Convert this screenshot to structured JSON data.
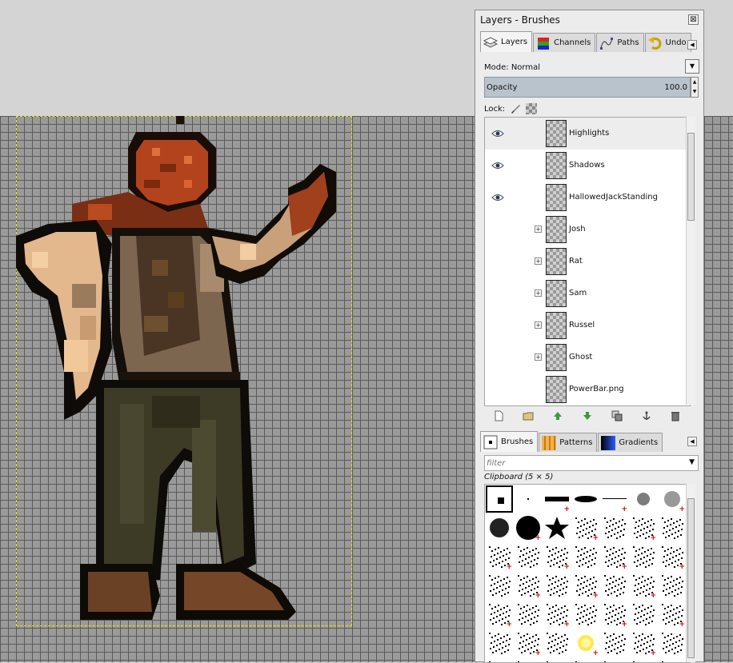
{
  "dock": {
    "title": "Layers - Brushes",
    "close_glyph": "⊠"
  },
  "top_tabs": [
    {
      "label": "Layers",
      "icon": "layers-icon",
      "active": true
    },
    {
      "label": "Channels",
      "icon": "channels-icon",
      "active": false
    },
    {
      "label": "Paths",
      "icon": "paths-icon",
      "active": false
    },
    {
      "label": "Undo",
      "icon": "undo-icon",
      "active": false
    }
  ],
  "mode": {
    "label": "Mode:",
    "value": "Normal"
  },
  "opacity": {
    "label": "Opacity",
    "value": "100.0"
  },
  "lock": {
    "label": "Lock:"
  },
  "layers": [
    {
      "name": "Highlights",
      "visible": true,
      "expandable": false,
      "selected": true
    },
    {
      "name": "Shadows",
      "visible": true,
      "expandable": false,
      "selected": false
    },
    {
      "name": "HallowedJackStanding",
      "visible": true,
      "expandable": false,
      "selected": false
    },
    {
      "name": "Josh",
      "visible": false,
      "expandable": true,
      "selected": false
    },
    {
      "name": "Rat",
      "visible": false,
      "expandable": true,
      "selected": false
    },
    {
      "name": "Sam",
      "visible": false,
      "expandable": true,
      "selected": false
    },
    {
      "name": "Russel",
      "visible": false,
      "expandable": true,
      "selected": false
    },
    {
      "name": "Ghost",
      "visible": false,
      "expandable": true,
      "selected": false
    },
    {
      "name": "PowerBar.png",
      "visible": false,
      "expandable": false,
      "selected": false
    }
  ],
  "layer_buttons": [
    "new-layer-icon",
    "new-group-icon",
    "raise-layer-icon",
    "lower-layer-icon",
    "duplicate-layer-icon",
    "anchor-layer-icon",
    "delete-layer-icon"
  ],
  "bottom_tabs": [
    {
      "label": "Brushes",
      "icon": "brushes-icon",
      "active": true
    },
    {
      "label": "Patterns",
      "icon": "patterns-icon",
      "active": false
    },
    {
      "label": "Gradients",
      "icon": "gradients-icon",
      "active": false
    }
  ],
  "brush_filter": {
    "placeholder": "filter"
  },
  "brush_info": "Clipboard (5 × 5)",
  "colors": {
    "canvas_bg": "#9a9a9a",
    "grid": "#5a5a5a",
    "boundary": "#e6e600",
    "opacity_bar": "#b9c3cc"
  }
}
